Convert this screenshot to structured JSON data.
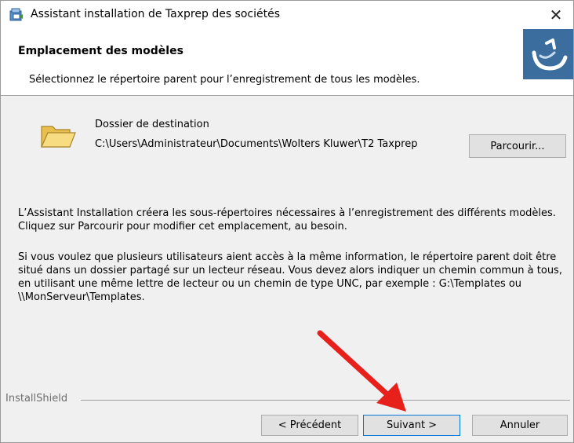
{
  "window": {
    "title": "Assistant installation de Taxprep des sociétés",
    "close_label": "✕"
  },
  "header": {
    "title": "Emplacement des modèles",
    "subtitle": "Sélectionnez le répertoire parent pour l’enregistrement de tous les modèles."
  },
  "destination": {
    "label": "Dossier de destination",
    "path": "C:\\Users\\Administrateur\\Documents\\Wolters Kluwer\\T2 Taxprep",
    "browse_label": "Parcourir..."
  },
  "body": {
    "paragraph1": "L’Assistant Installation créera les sous-répertoires nécessaires à l’enregistrement des différents modèles. Cliquez sur Parcourir pour modifier cet emplacement, au besoin.",
    "paragraph2": "Si vous voulez que plusieurs utilisateurs aient accès à la même information, le répertoire parent doit être situé dans un dossier partagé sur un lecteur réseau. Vous devez alors indiquer un chemin commun à tous, en utilisant une même lettre de lecteur ou un chemin de type UNC, par exemple : G:\\Templates ou  \\\\MonServeur\\Templates."
  },
  "footer": {
    "brand": "InstallShield",
    "prev_label": "< Précédent",
    "next_label": "Suivant >",
    "cancel_label": "Annuler"
  },
  "colors": {
    "arrow": "#e8201c",
    "header_logo": "#3b6e9e",
    "folder": "#f2cf63",
    "focus_border": "#0078d7"
  },
  "icons": {
    "app": "installer-icon",
    "header": "installshield-logo",
    "folder": "folder-icon",
    "close": "close-icon"
  }
}
